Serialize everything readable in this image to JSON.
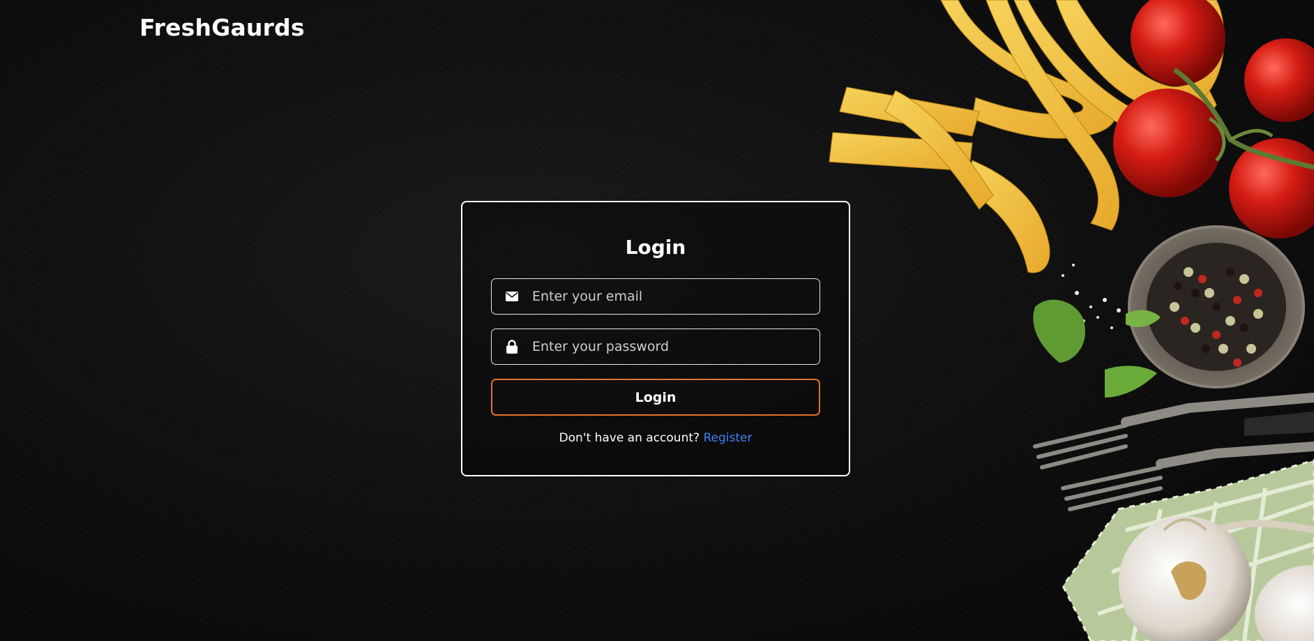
{
  "header": {
    "brand": "FreshGaurds"
  },
  "login_form": {
    "title": "Login",
    "email": {
      "placeholder": "Enter your email",
      "value": "",
      "icon": "envelope-icon"
    },
    "password": {
      "placeholder": "Enter your password",
      "value": "",
      "icon": "lock-icon"
    },
    "submit_label": "Login",
    "register_prompt": "Don't have an account?",
    "register_link": "Register"
  },
  "colors": {
    "background": "#0e0e0e",
    "accent_border": "#e0722c",
    "link": "#3b82f6",
    "text": "#ffffff"
  }
}
